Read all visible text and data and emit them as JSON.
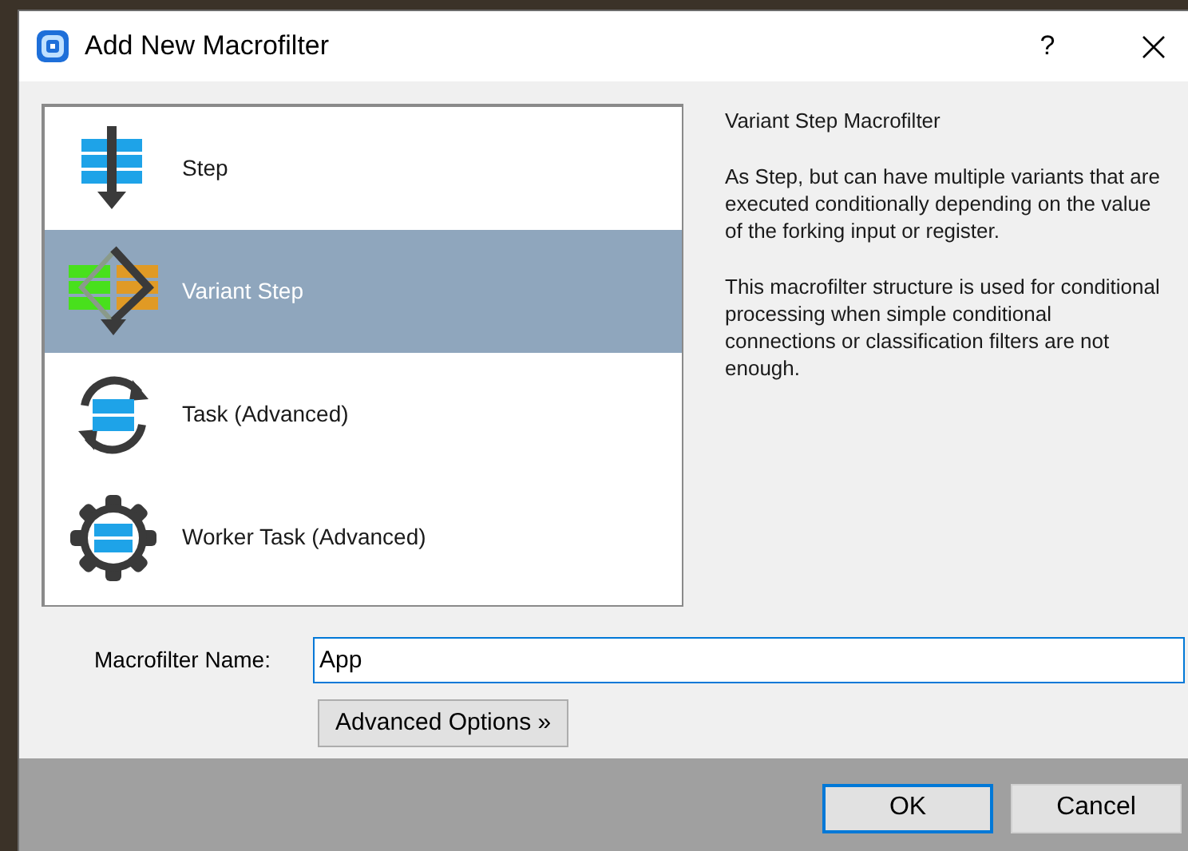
{
  "window": {
    "title": "Add New Macrofilter",
    "help": "?"
  },
  "structures": [
    {
      "kind": "step",
      "label": "Step",
      "selected": false
    },
    {
      "kind": "variant",
      "label": "Variant Step",
      "selected": true
    },
    {
      "kind": "task",
      "label": "Task (Advanced)",
      "selected": false
    },
    {
      "kind": "worker",
      "label": "Worker Task (Advanced)",
      "selected": false
    }
  ],
  "description": {
    "title": "Variant Step Macrofilter",
    "paragraphs": [
      "As Step, but can have multiple variants that are executed conditionally depending on the value of the forking input or register.",
      "This macrofilter structure is used for conditional processing when simple conditional connections or classification filters are not enough."
    ]
  },
  "name_field": {
    "label": "Macrofilter Name:",
    "value": "App"
  },
  "advanced_button": "Advanced Options »",
  "buttons": [
    {
      "label": "OK",
      "default": true
    },
    {
      "label": "Cancel",
      "default": false
    }
  ]
}
